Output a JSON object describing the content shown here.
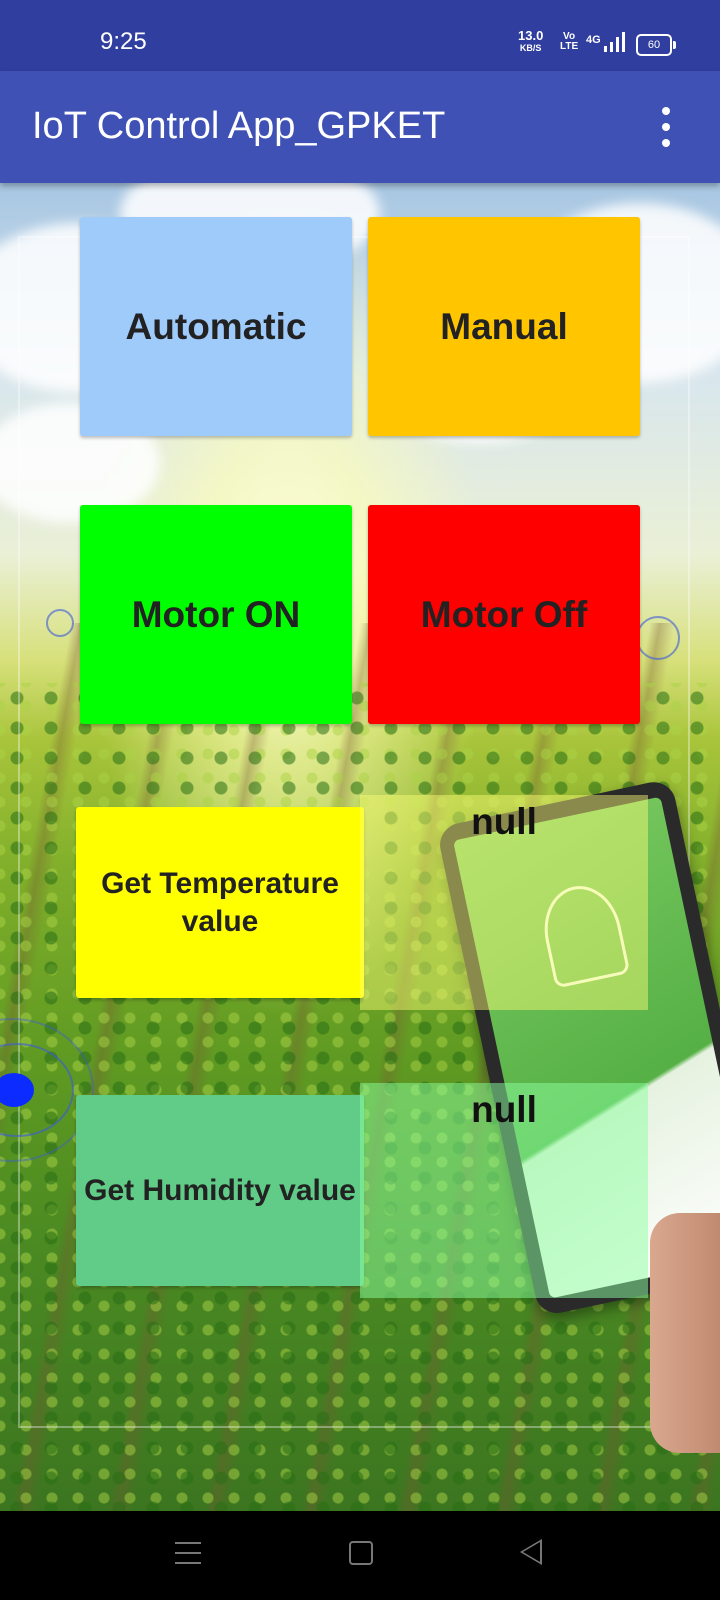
{
  "status_bar": {
    "time": "9:25",
    "speed_value": "13.0",
    "speed_unit": "KB/S",
    "volte_top": "Vo",
    "volte_bottom": "LTE",
    "network": "4G",
    "battery": "60"
  },
  "app_bar": {
    "title": "IoT Control App_GPKET",
    "overflow_icon": "more-vert-icon"
  },
  "controls": {
    "automatic": "Automatic",
    "manual": "Manual",
    "motor_on": "Motor ON",
    "motor_off": "Motor Off",
    "get_temperature": "Get Temperature value",
    "get_humidity": "Get Humidity value"
  },
  "readouts": {
    "temperature": "null",
    "humidity": "null"
  },
  "colors": {
    "status_bar": "#303f9f",
    "app_bar": "#3f51b5",
    "automatic": "#9fcbfa",
    "manual": "#ffc600",
    "motor_on": "#00ff00",
    "motor_off": "#ff0000",
    "get_temperature": "#ffff00",
    "get_humidity": "#60cc88"
  },
  "nav_bar": {
    "recents_icon": "menu-icon",
    "home_icon": "square-icon",
    "back_icon": "back-triangle-icon"
  }
}
